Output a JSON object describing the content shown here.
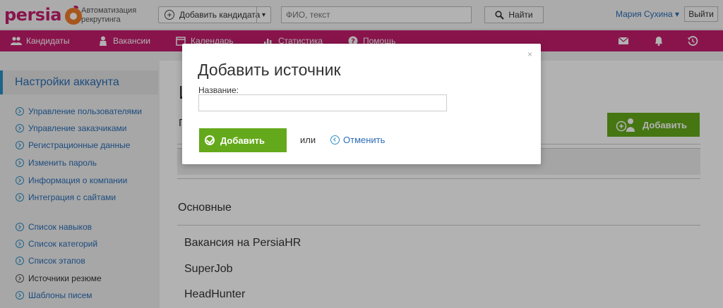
{
  "header": {
    "logo_text": "persia",
    "tagline": "Автоматизация рекрутинга",
    "add_candidate_label": "Добавить кандидата",
    "search_placeholder": "ФИО, текст",
    "search_button": "Найти",
    "user_name": "Мария Сухина",
    "logout": "Выйти"
  },
  "nav": {
    "items": [
      {
        "label": "Кандидаты",
        "icon": "users-icon"
      },
      {
        "label": "Вакансии",
        "icon": "person-icon"
      },
      {
        "label": "Календарь",
        "icon": "calendar-icon"
      },
      {
        "label": "Статистика",
        "icon": "bar-chart-icon"
      },
      {
        "label": "Помощь",
        "icon": "help-icon"
      }
    ],
    "right_icons": [
      "mail-icon",
      "bell-icon",
      "history-icon"
    ]
  },
  "sidebar": {
    "title": "Настройки аккаунта",
    "group1": [
      "Управление пользователями",
      "Управление заказчиками",
      "Регистрационные данные",
      "Изменить пароль",
      "Информация о компании",
      "Интеграция с сайтами"
    ],
    "group2": [
      "Список навыков",
      "Список категорий",
      "Список этапов",
      "Источники резюме",
      "Шаблоны писем"
    ],
    "active": "Источники резюме"
  },
  "main": {
    "heading_partial": "И",
    "sub_partial": "П",
    "add_button": "Добавить",
    "section_title": "Основные",
    "sources": [
      "Вакансия на PersiaHR",
      "SuperJob",
      "HeadHunter"
    ]
  },
  "modal": {
    "title": "Добавить источник",
    "close": "×",
    "name_label": "Название:",
    "name_value": "",
    "submit": "Добавить",
    "or": "или",
    "cancel": "Отменить"
  },
  "colors": {
    "brand": "#c41d6e",
    "link": "#2a6db5",
    "green": "#64a91b"
  }
}
